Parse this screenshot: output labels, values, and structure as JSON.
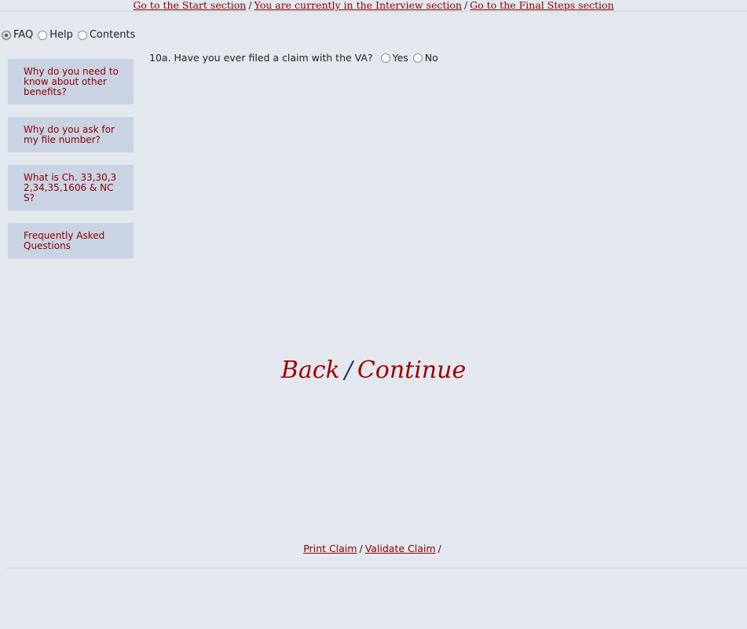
{
  "top_nav": {
    "start_link": "Go to the Start section",
    "current_text": "You are currently in the Interview section",
    "final_link": "Go to the Final Steps section",
    "separator": "/"
  },
  "side_tabs": {
    "options": [
      {
        "label": "FAQ",
        "selected": true
      },
      {
        "label": "Help",
        "selected": false
      },
      {
        "label": "Contents",
        "selected": false
      }
    ]
  },
  "faq_items": [
    {
      "label": "Why do you need to know about other benefits?"
    },
    {
      "label": "Why do you ask for my file number?"
    },
    {
      "label": "What is Ch. 33,30,32,34,35,1606 & NCS?"
    },
    {
      "label": "Frequently Asked Questions"
    }
  ],
  "question": {
    "text": "10a. Have you ever filed a claim with the VA?",
    "options": [
      {
        "label": "Yes",
        "selected": false
      },
      {
        "label": "No",
        "selected": false
      }
    ]
  },
  "nav_main": {
    "back_label": "Back",
    "separator": "/",
    "continue_label": "Continue"
  },
  "bottom_nav": {
    "print_label": "Print Claim",
    "validate_label": "Validate Claim",
    "separator": "/"
  },
  "colors": {
    "background": "#e3e8ee",
    "link": "#8b0000",
    "faq_box": "#c9d3e3",
    "slash": "#1e2f6e"
  }
}
